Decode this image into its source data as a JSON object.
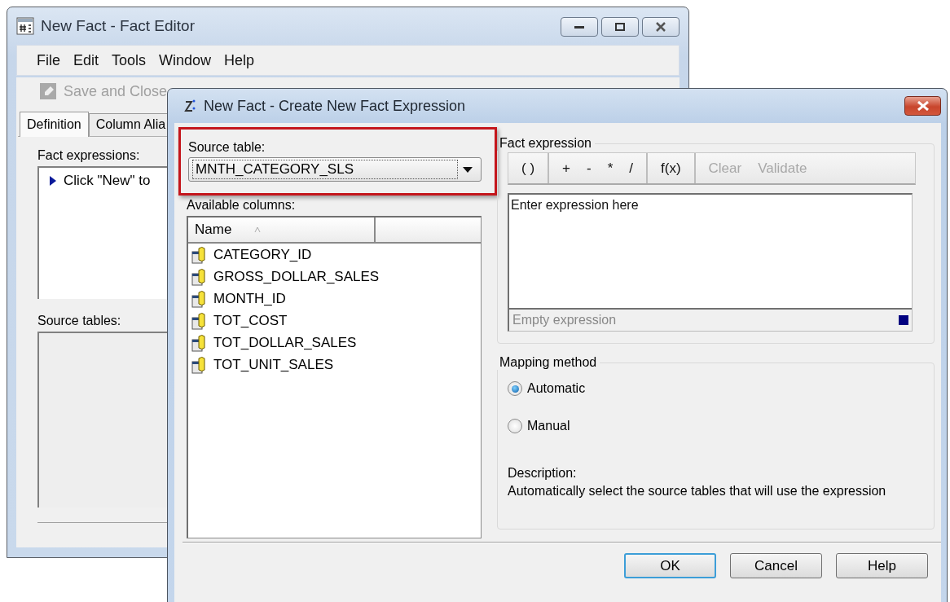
{
  "editor_window": {
    "title": "New Fact - Fact Editor",
    "menu": [
      "File",
      "Edit",
      "Tools",
      "Window",
      "Help"
    ],
    "save_and_close": {
      "label": "Save and Close",
      "disabled": true
    },
    "tabs": [
      {
        "label": "Definition",
        "selected": true
      },
      {
        "label": "Column Alia",
        "selected": false
      }
    ],
    "fact_expressions": {
      "label": "Fact expressions:",
      "items": [
        {
          "text": "Click \"New\" to"
        }
      ]
    },
    "source_tables": {
      "label": "Source tables:"
    }
  },
  "dialog": {
    "title": "New Fact - Create New Fact Expression",
    "source_table": {
      "label": "Source table:",
      "value": "MNTH_CATEGORY_SLS",
      "highlighted": true
    },
    "available_columns": {
      "label": "Available columns:",
      "columns": [
        {
          "label": "Name",
          "sorted": true
        }
      ],
      "rows": [
        "CATEGORY_ID",
        "GROSS_DOLLAR_SALES",
        "MONTH_ID",
        "TOT_COST",
        "TOT_DOLLAR_SALES",
        "TOT_UNIT_SALES"
      ]
    },
    "fact_expression": {
      "label": "Fact expression",
      "toolbar_groups": [
        [
          {
            "label": "( )",
            "disabled": false
          }
        ],
        [
          {
            "label": "+",
            "disabled": false
          },
          {
            "label": "-",
            "disabled": false
          },
          {
            "label": "*",
            "disabled": false
          },
          {
            "label": "/",
            "disabled": false
          }
        ],
        [
          {
            "label": "f(x)",
            "disabled": false
          }
        ],
        [
          {
            "label": "Clear",
            "disabled": true
          },
          {
            "label": "Validate",
            "disabled": true
          }
        ]
      ],
      "placeholder": "Enter expression here",
      "status": "Empty expression"
    },
    "mapping_method": {
      "label": "Mapping method",
      "options": [
        {
          "label": "Automatic",
          "selected": true
        },
        {
          "label": "Manual",
          "selected": false
        }
      ],
      "description_label": "Description:",
      "description": "Automatically select the source tables that will use the expression"
    },
    "buttons": [
      {
        "label": "OK",
        "default": true
      },
      {
        "label": "Cancel",
        "default": false
      },
      {
        "label": "Help",
        "default": false
      }
    ]
  }
}
